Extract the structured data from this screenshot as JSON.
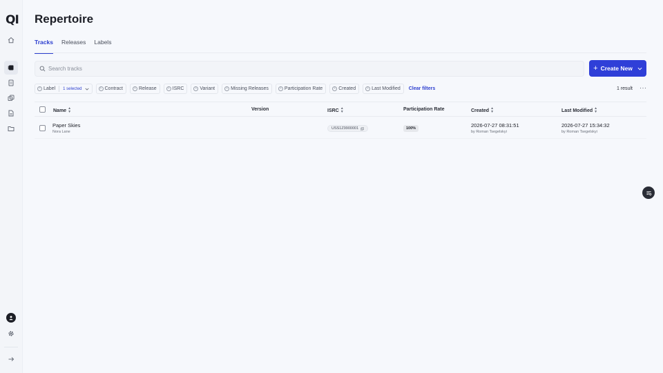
{
  "app": {
    "logo_text": "QI"
  },
  "sidebar": {
    "items": [
      {
        "name": "home-icon"
      },
      {
        "name": "tracks-icon"
      },
      {
        "name": "document-icon"
      },
      {
        "name": "stack-icon"
      },
      {
        "name": "file-icon"
      },
      {
        "name": "folder-icon"
      }
    ],
    "bottom": [
      {
        "name": "user-avatar-icon"
      },
      {
        "name": "gear-icon"
      },
      {
        "name": "arrow-right-icon"
      }
    ]
  },
  "header": {
    "title": "Repertoire",
    "tabs": [
      {
        "label": "Tracks",
        "active": true
      },
      {
        "label": "Releases",
        "active": false
      },
      {
        "label": "Labels",
        "active": false
      }
    ]
  },
  "search": {
    "placeholder": "Search tracks",
    "value": ""
  },
  "create": {
    "label": "Create New"
  },
  "filters": {
    "chips": [
      {
        "label": "Label",
        "selected": "1 selected"
      },
      {
        "label": "Contract"
      },
      {
        "label": "Release"
      },
      {
        "label": "ISRC"
      },
      {
        "label": "Variant"
      },
      {
        "label": "Missing Releases"
      },
      {
        "label": "Participation Rate"
      },
      {
        "label": "Created"
      },
      {
        "label": "Last Modified"
      }
    ],
    "clear_label": "Clear filters",
    "results": "1 result",
    "more": "···"
  },
  "table": {
    "columns": {
      "name": "Name",
      "version": "Version",
      "isrc": "ISRC",
      "participation_rate": "Participation Rate",
      "created": "Created",
      "last_modified": "Last Modified"
    },
    "rows": [
      {
        "name": "Paper Skies",
        "artist": "Nora Lane",
        "version": "",
        "isrc": "USS1Z9900001",
        "participation_rate": "100%",
        "created": "2026-07-27 08:31:51",
        "created_by": "by Roman Tsegelskyi",
        "last_modified": "2026-07-27 15:34:32",
        "modified_by": "by Roman Tsegelskyi"
      }
    ]
  },
  "colors": {
    "accent": "#2f3fd8",
    "background": "#f6f8fc"
  }
}
